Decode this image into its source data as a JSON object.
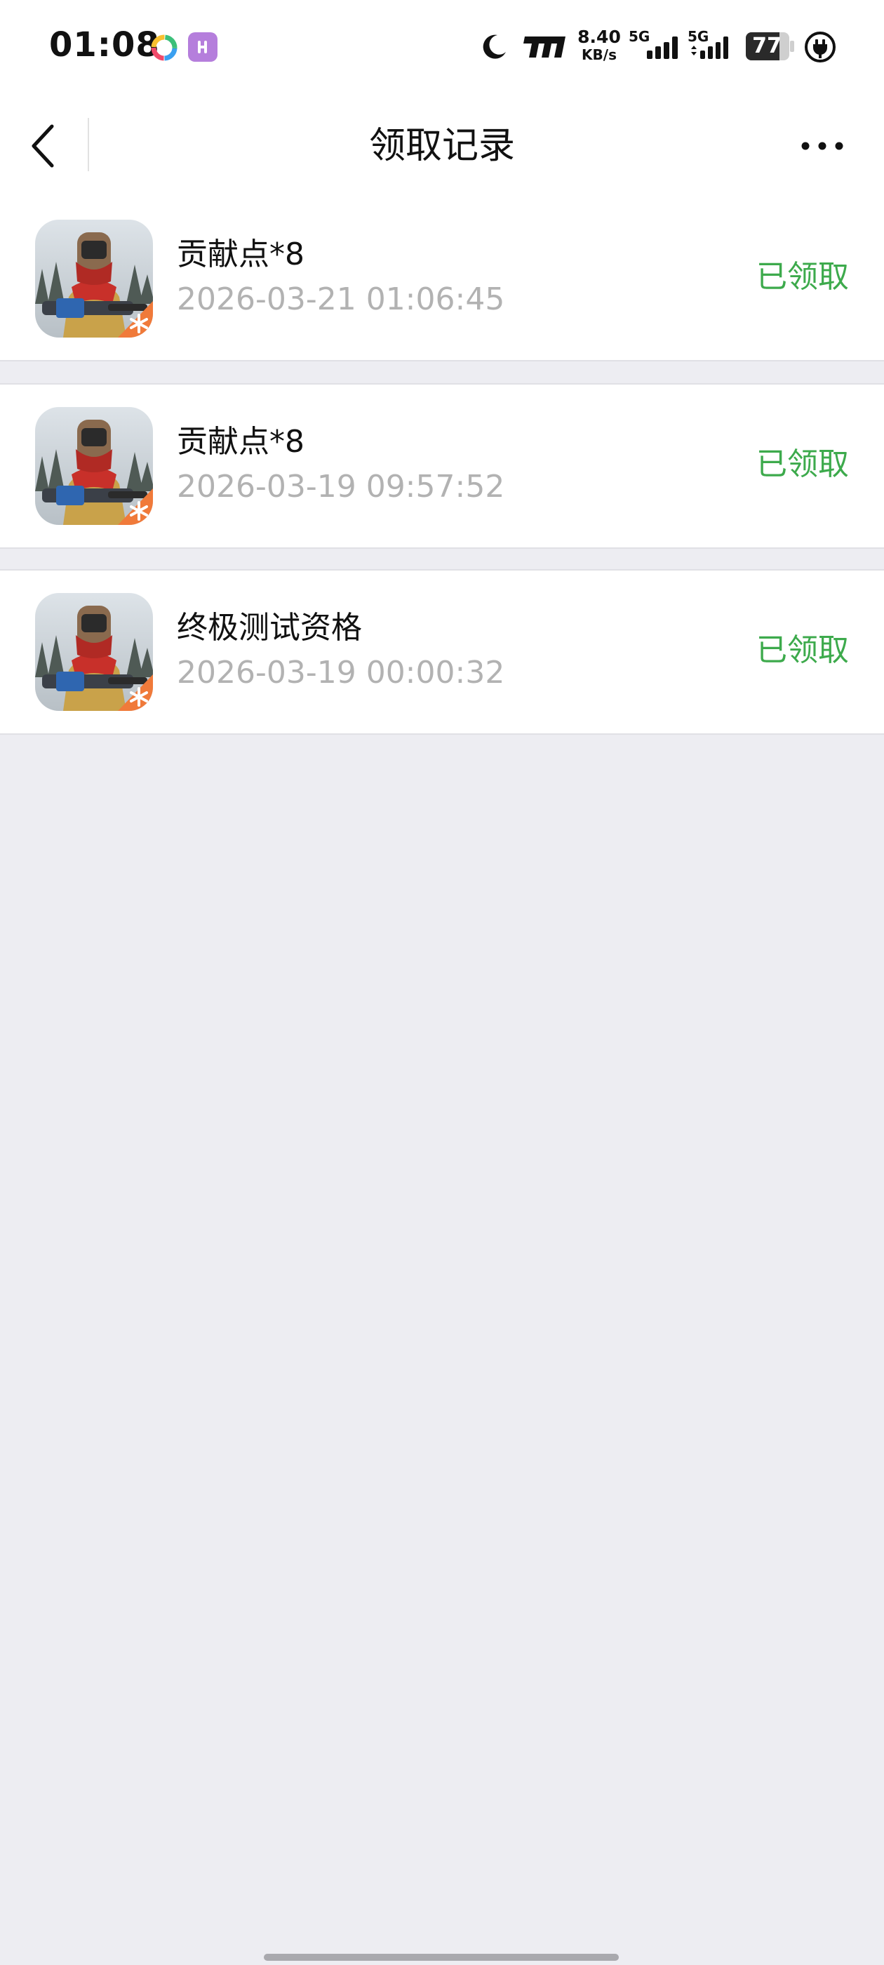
{
  "status_bar": {
    "time": "01:08",
    "net_speed_value": "8.40",
    "net_speed_unit": "KB/s",
    "sim1_label": "5G",
    "sim2_label": "5G",
    "battery_level": "77",
    "icons": [
      "colorful-app-notification-icon",
      "purple-app-notification-icon",
      "moon-icon",
      "brand-icon",
      "signal-icon",
      "battery-icon",
      "charging-plug-icon"
    ]
  },
  "nav": {
    "title": "领取记录",
    "back_icon": "chevron-left-icon",
    "more_icon": "more-dots-icon"
  },
  "colors": {
    "status_claimed": "#3DAA4C",
    "background": "#EDEDF2",
    "card": "#FFFFFF",
    "secondary_text": "#B2B2B2",
    "primary_text": "#111111"
  },
  "records": [
    {
      "name": "贡献点*8",
      "time": "2026-03-21 01:06:45",
      "status": "已领取",
      "icon": "game-app-icon"
    },
    {
      "name": "贡献点*8",
      "time": "2026-03-19 09:57:52",
      "status": "已领取",
      "icon": "game-app-icon"
    },
    {
      "name": "终极测试资格",
      "time": "2026-03-19 00:00:32",
      "status": "已领取",
      "icon": "game-app-icon"
    }
  ]
}
